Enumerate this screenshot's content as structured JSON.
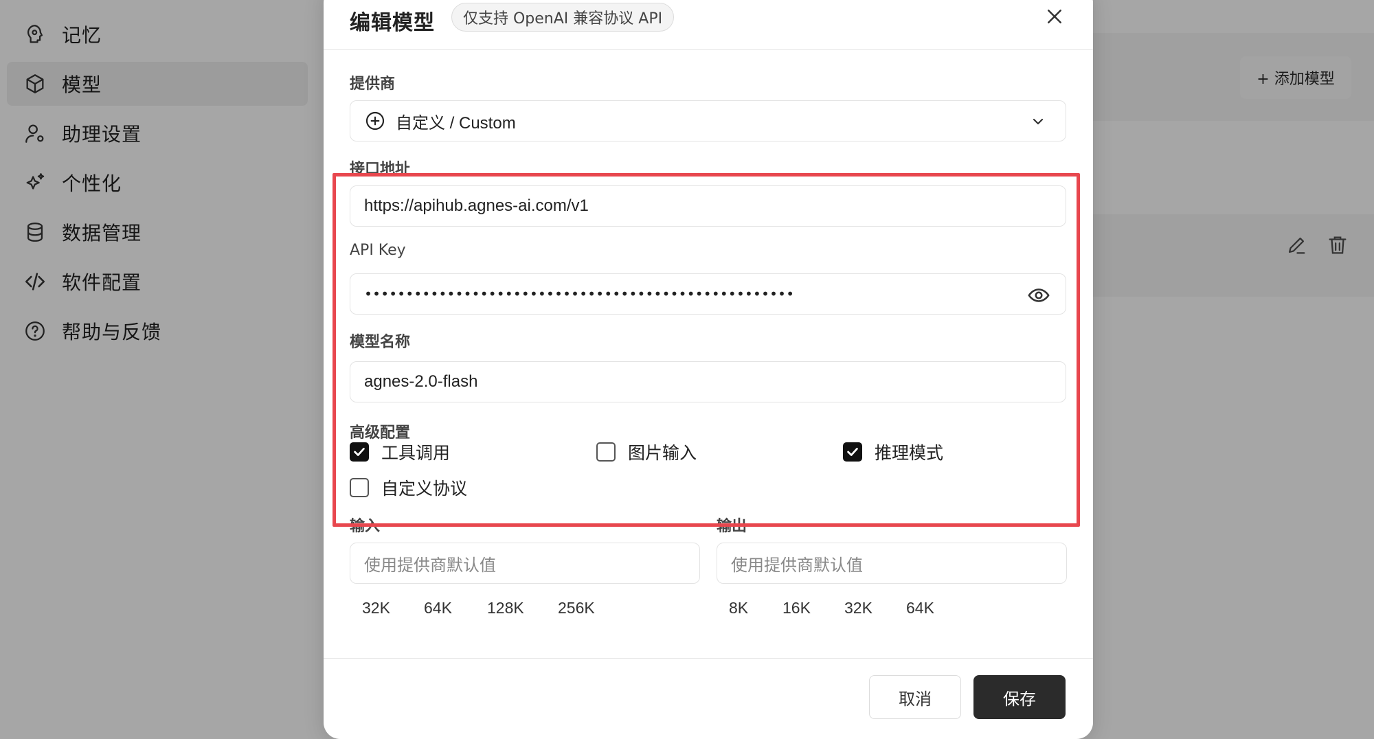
{
  "sidebar": {
    "items": [
      {
        "label": "记忆",
        "icon": "memory-icon"
      },
      {
        "label": "模型",
        "icon": "cube-icon",
        "active": true
      },
      {
        "label": "助理设置",
        "icon": "user-settings-icon"
      },
      {
        "label": "个性化",
        "icon": "sparkles-icon"
      },
      {
        "label": "数据管理",
        "icon": "database-icon"
      },
      {
        "label": "软件配置",
        "icon": "code-icon"
      },
      {
        "label": "帮助与反馈",
        "icon": "help-icon"
      }
    ]
  },
  "background": {
    "add_model_label": "+ 添加模型"
  },
  "modal": {
    "title": "编辑模型",
    "badge": "仅支持 OpenAI 兼容协议 API",
    "provider": {
      "label": "提供商",
      "value": "自定义 / Custom"
    },
    "endpoint": {
      "label": "接口地址",
      "value": "https://apihub.agnes-ai.com/v1"
    },
    "api_key": {
      "label": "API Key",
      "masked_value": "••••••••••••••••••••••••••••••••••••••••••••••••••••"
    },
    "model_name": {
      "label": "模型名称",
      "value": "agnes-2.0-flash"
    },
    "advanced": {
      "label": "高级配置",
      "options": [
        {
          "label": "工具调用",
          "checked": true
        },
        {
          "label": "图片输入",
          "checked": false
        },
        {
          "label": "推理模式",
          "checked": true
        },
        {
          "label": "自定义协议",
          "checked": false
        }
      ]
    },
    "input_ctx": {
      "label": "输入",
      "placeholder": "使用提供商默认值",
      "presets": [
        "32K",
        "64K",
        "128K",
        "256K"
      ]
    },
    "output_ctx": {
      "label": "输出",
      "placeholder": "使用提供商默认值",
      "presets": [
        "8K",
        "16K",
        "32K",
        "64K"
      ]
    },
    "cancel_label": "取消",
    "save_label": "保存"
  },
  "colors": {
    "highlight": "#e8474e",
    "primary_button": "#2b2b2b",
    "overlay": "#a6a6a6"
  }
}
